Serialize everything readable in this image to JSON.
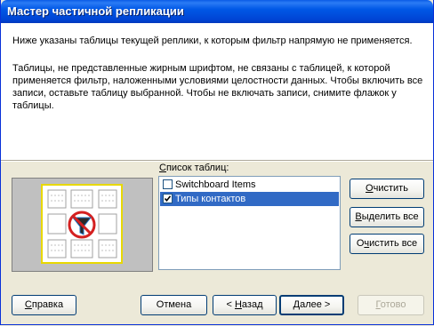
{
  "window": {
    "title": "Мастер частичной репликации"
  },
  "intro": {
    "line1": "Ниже указаны таблицы текущей реплики, к которым фильтр напрямую не применяется.",
    "paragraph": " Таблицы, не представленные жирным шрифтом, не связаны с таблицей, к которой применяется фильтр, наложенными условиями целостности данных. Чтобы включить все записи, оставьте таблицу выбранной. Чтобы не включать записи, снимите флажок у таблицы."
  },
  "tables": {
    "label_underlined": "С",
    "label_rest": "писок таблиц:",
    "items": [
      {
        "label": "Switchboard Items",
        "checked": false,
        "selected": false
      },
      {
        "label": "Типы контактов",
        "checked": true,
        "selected": true
      }
    ]
  },
  "side_buttons": {
    "clear": {
      "underlined": "О",
      "rest": "чистить"
    },
    "select_all": {
      "underlined": "В",
      "rest": "ыделить все"
    },
    "clear_all": {
      "prefix": "О",
      "underlined": "ч",
      "rest": "истить все"
    }
  },
  "footer_buttons": {
    "help": {
      "underlined": "С",
      "rest": "правка"
    },
    "cancel": {
      "label": "Отмена"
    },
    "back": {
      "prefix": "< ",
      "underlined": "Н",
      "rest": "азад"
    },
    "next": {
      "underlined": "Д",
      "rest": "алее >"
    },
    "finish": {
      "underlined": "Г",
      "rest": "отово",
      "enabled": false
    }
  }
}
